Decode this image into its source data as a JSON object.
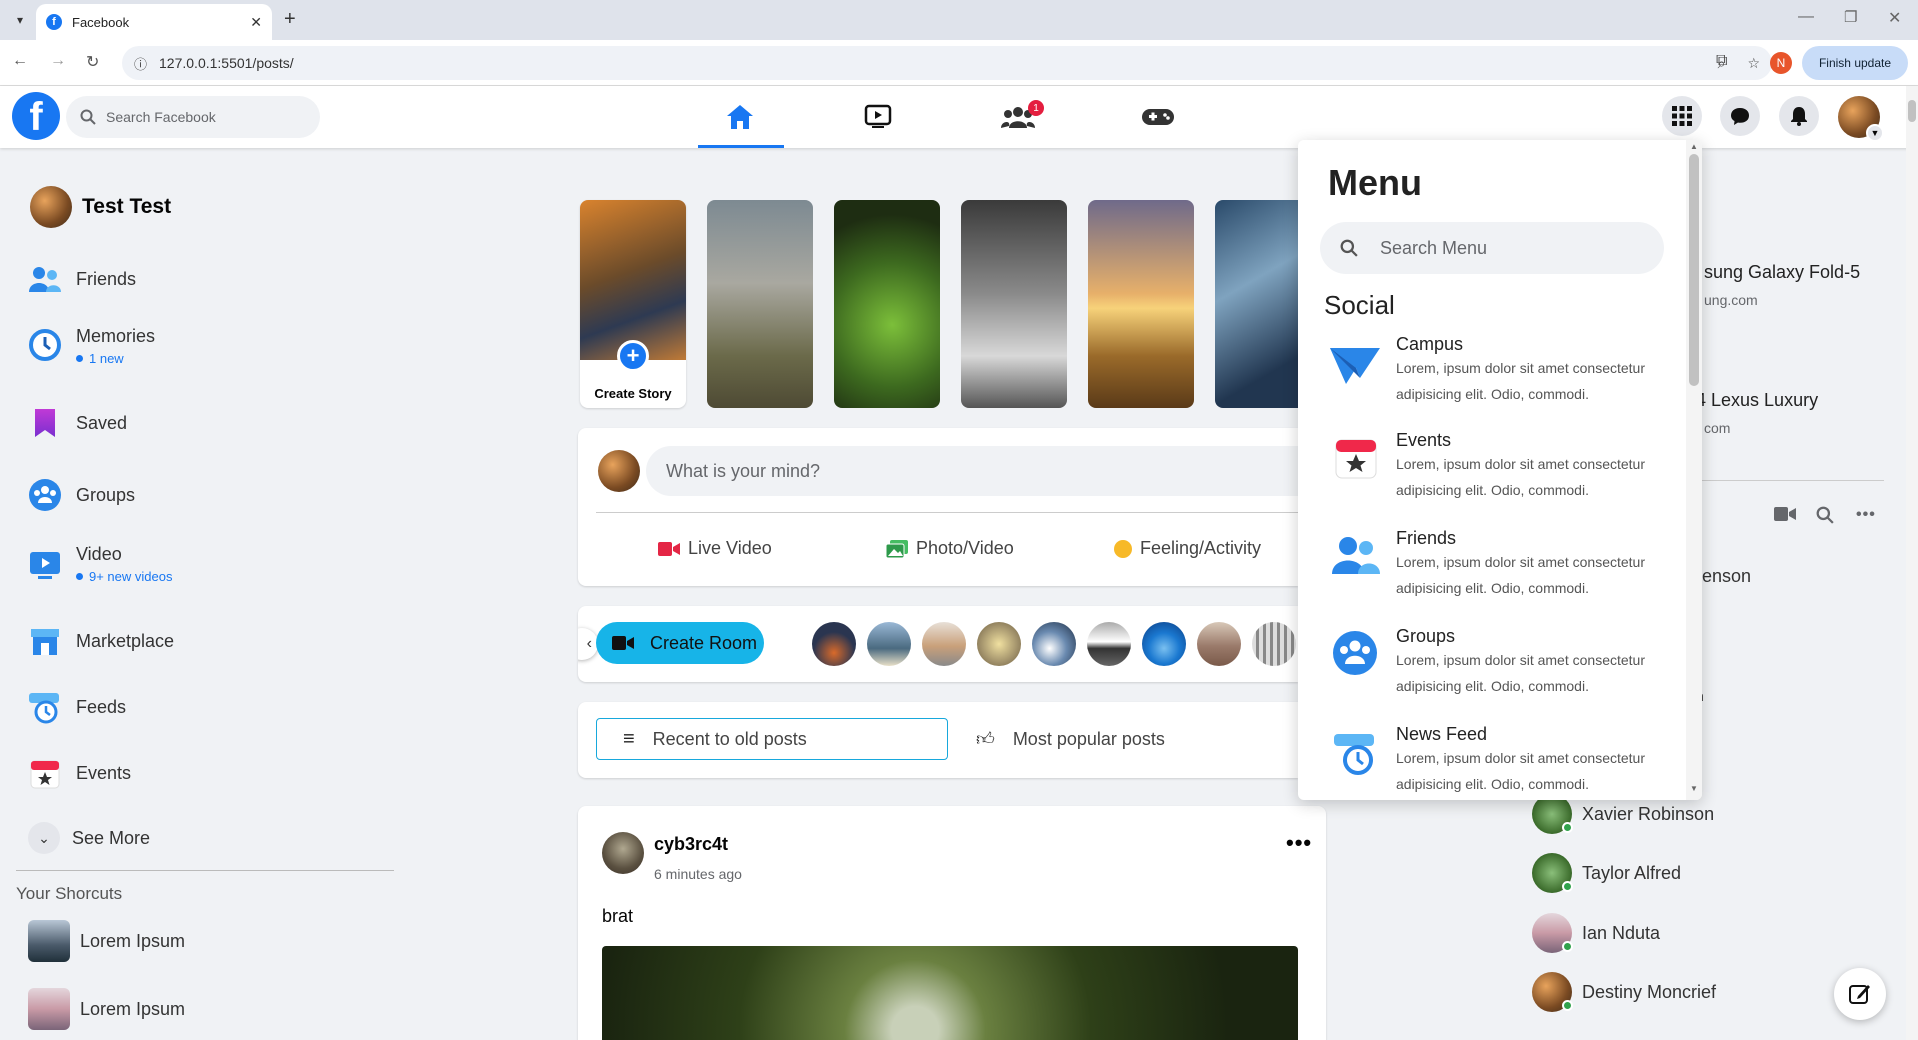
{
  "browser": {
    "tab_title": "Facebook",
    "url": "127.0.0.1:5501/posts/",
    "profile_initial": "N",
    "finish_update": "Finish update"
  },
  "header": {
    "search_placeholder": "Search Facebook",
    "friends_badge": "1",
    "accent": "#1877f2"
  },
  "sidebar": {
    "user_name": "Test Test",
    "items": [
      {
        "label": "Friends",
        "sub": ""
      },
      {
        "label": "Memories",
        "sub": "1 new"
      },
      {
        "label": "Saved",
        "sub": ""
      },
      {
        "label": "Groups",
        "sub": ""
      },
      {
        "label": "Video",
        "sub": "9+ new videos"
      },
      {
        "label": "Marketplace",
        "sub": ""
      },
      {
        "label": "Feeds",
        "sub": ""
      },
      {
        "label": "Events",
        "sub": ""
      }
    ],
    "see_more": "See More",
    "shortcuts_title": "Your Shorcuts",
    "shortcuts": [
      "Lorem Ipsum",
      "Lorem Ipsum"
    ]
  },
  "stories": {
    "create_label": "Create Story"
  },
  "composer": {
    "placeholder": "What is your mind?",
    "live_video": "Live Video",
    "photo_video": "Photo/Video",
    "feeling": "Feeling/Activity"
  },
  "rooms": {
    "create_room": "Create Room"
  },
  "sort": {
    "recent": "Recent to old posts",
    "popular": "Most popular posts"
  },
  "post": {
    "author": "cyb3rc4t",
    "time": "6 minutes ago",
    "text": "brat"
  },
  "menu": {
    "title": "Menu",
    "search_placeholder": "Search Menu",
    "section": "Social",
    "items": [
      {
        "title": "Campus",
        "desc": "Lorem, ipsum dolor sit amet consectetur adipisicing elit. Odio, commodi."
      },
      {
        "title": "Events",
        "desc": "Lorem, ipsum dolor sit amet consectetur adipisicing elit. Odio, commodi."
      },
      {
        "title": "Friends",
        "desc": "Lorem, ipsum dolor sit amet consectetur adipisicing elit. Odio, commodi."
      },
      {
        "title": "Groups",
        "desc": "Lorem, ipsum dolor sit amet consectetur adipisicing elit. Odio, commodi."
      },
      {
        "title": "News Feed",
        "desc": "Lorem, ipsum dolor sit amet consectetur adipisicing elit. Odio, commodi."
      }
    ]
  },
  "right": {
    "ad1_title": "sung Galaxy Fold-5",
    "ad1_site": "ung.com",
    "ad2_title": "4 Lexus Luxury",
    "ad2_site": "com",
    "partial_contact": "enson",
    "partial_char": "n",
    "contacts": [
      "Xavier Robinson",
      "Taylor Alfred",
      "Ian Nduta",
      "Destiny Moncrief"
    ]
  }
}
